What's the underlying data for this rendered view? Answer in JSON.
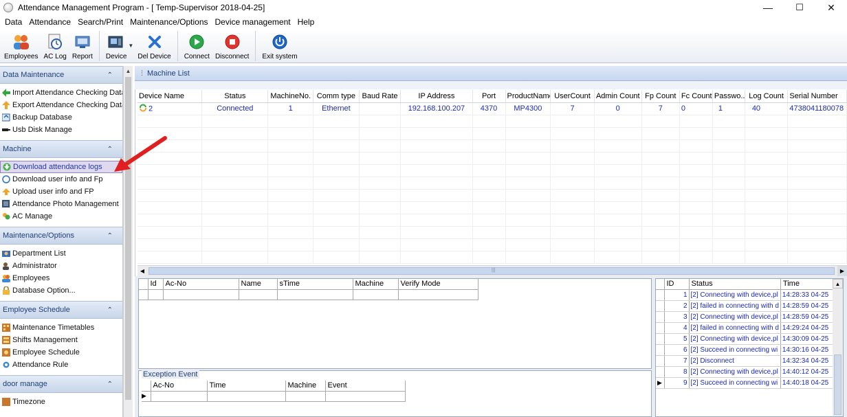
{
  "window": {
    "title": "Attendance Management Program - [ Temp-Supervisor 2018-04-25]",
    "minimize": "—",
    "maximize": "☐",
    "close": "✕"
  },
  "menu": [
    "Data",
    "Attendance",
    "Search/Print",
    "Maintenance/Options",
    "Device management",
    "Help"
  ],
  "toolbar": {
    "employees": "Employees",
    "aclog": "AC Log",
    "report": "Report",
    "device": "Device",
    "del_device": "Del Device",
    "connect": "Connect",
    "disconnect": "Disconnect",
    "exit": "Exit system"
  },
  "sidebar": {
    "data_maintenance": {
      "title": "Data Maintenance",
      "items": [
        "Import Attendance Checking Data",
        "Export Attendance Checking Data",
        "Backup Database",
        "Usb Disk Manage"
      ]
    },
    "machine": {
      "title": "Machine",
      "items": [
        "Download attendance logs",
        "Download user info and Fp",
        "Upload user info and FP",
        "Attendance Photo Management",
        "AC Manage"
      ]
    },
    "maintenance": {
      "title": "Maintenance/Options",
      "items": [
        "Department List",
        "Administrator",
        "Employees",
        "Database Option..."
      ]
    },
    "schedule": {
      "title": "Employee Schedule",
      "items": [
        "Maintenance Timetables",
        "Shifts Management",
        "Employee Schedule",
        "Attendance Rule"
      ]
    },
    "door": {
      "title": "door manage",
      "items": [
        "Timezone"
      ]
    }
  },
  "machine_list": {
    "title": "Machine List",
    "columns": [
      "Device Name",
      "Status",
      "MachineNo.",
      "Comm type",
      "Baud Rate",
      "IP Address",
      "Port",
      "ProductName",
      "UserCount",
      "Admin Count",
      "Fp Count",
      "Fc Count",
      "Passwo...",
      "Log Count",
      "Serial Number"
    ],
    "row": [
      "2",
      "Connected",
      "1",
      "Ethernet",
      "",
      "192.168.100.207",
      "4370",
      "MP4300",
      "7",
      "0",
      "7",
      "0",
      "1",
      "40",
      "4738041180078"
    ]
  },
  "logs_grid": {
    "columns": [
      "Id",
      "Ac-No",
      "Name",
      "sTime",
      "Machine",
      "Verify Mode"
    ]
  },
  "exception": {
    "title": "Exception Event",
    "columns": [
      "Ac-No",
      "Time",
      "Machine",
      "Event"
    ]
  },
  "status_log": {
    "columns": [
      "ID",
      "Status",
      "Time"
    ],
    "rows": [
      [
        "1",
        "[2] Connecting with device,pl",
        "14:28:33 04-25"
      ],
      [
        "2",
        "[2] failed in connecting with d",
        "14:28:59 04-25"
      ],
      [
        "3",
        "[2] Connecting with device,pl",
        "14:28:59 04-25"
      ],
      [
        "4",
        "[2] failed in connecting with d",
        "14:29:24 04-25"
      ],
      [
        "5",
        "[2] Connecting with device,pl",
        "14:30:09 04-25"
      ],
      [
        "6",
        "[2] Succeed in connecting wi",
        "14:30:16 04-25"
      ],
      [
        "7",
        "[2] Disconnect",
        "14:32:34 04-25"
      ],
      [
        "8",
        "[2] Connecting with device,pl",
        "14:40:12 04-25"
      ],
      [
        "9",
        "[2] Succeed in connecting wi",
        "14:40:18 04-25"
      ]
    ]
  }
}
